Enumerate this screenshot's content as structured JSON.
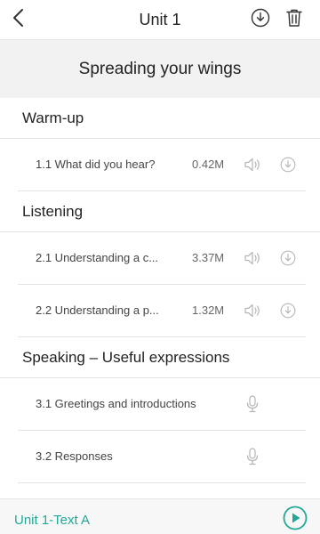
{
  "header": {
    "title": "Unit 1",
    "back_icon": "chevron-left-icon",
    "download_icon": "download-circle-icon",
    "trash_icon": "trash-icon"
  },
  "unit_title": "Spreading your wings",
  "sections": [
    {
      "title": "Warm-up",
      "items": [
        {
          "label": "1.1 What did you hear?",
          "size": "0.42M",
          "type": "audio"
        }
      ]
    },
    {
      "title": "Listening",
      "items": [
        {
          "label": "2.1 Understanding a c...",
          "size": "3.37M",
          "type": "audio"
        },
        {
          "label": "2.2 Understanding a p...",
          "size": "1.32M",
          "type": "audio"
        }
      ]
    },
    {
      "title": "Speaking – Useful expressions",
      "items": [
        {
          "label": "3.1 Greetings and introductions",
          "type": "record"
        },
        {
          "label": "3.2 Responses",
          "type": "record"
        }
      ]
    }
  ],
  "player": {
    "now_playing": "Unit 1-Text A",
    "play_icon": "play-circle-icon"
  },
  "colors": {
    "accent": "#22a898",
    "icon_gray": "#b5b5b5",
    "divider": "#e3e3e3",
    "subtitle_bg": "#f2f2f2"
  }
}
